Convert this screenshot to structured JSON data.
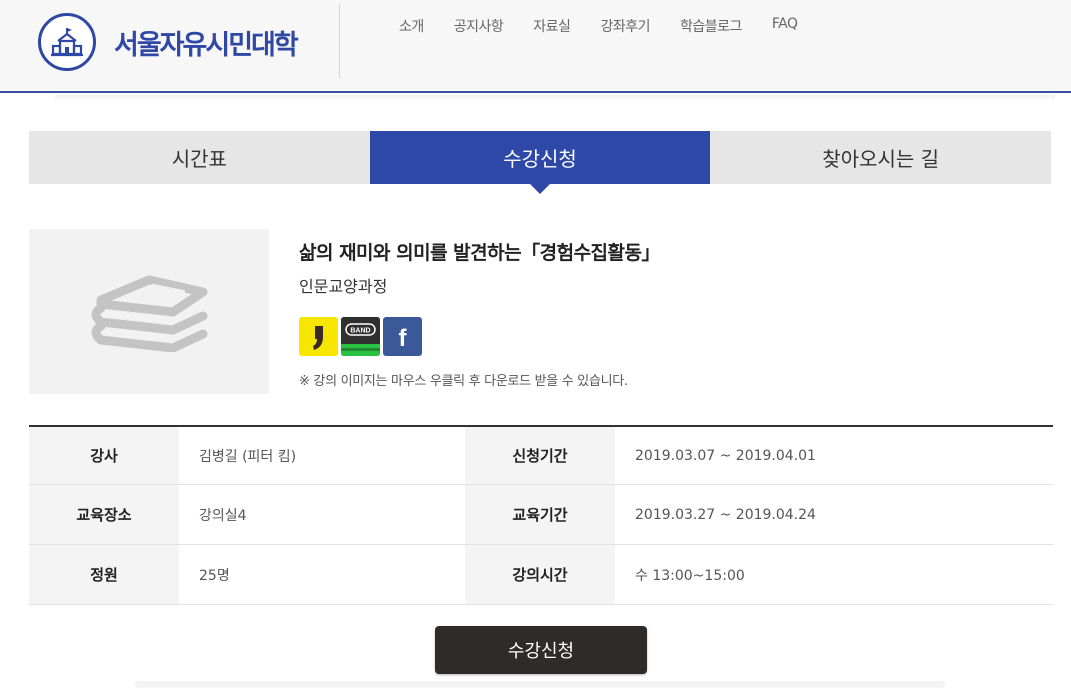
{
  "header": {
    "logo_text": "서울자유시민대학",
    "nav": [
      "소개",
      "공지사항",
      "자료실",
      "강좌후기",
      "학습블로그",
      "FAQ"
    ]
  },
  "tabs": [
    {
      "label": "시간표",
      "active": false
    },
    {
      "label": "수강신청",
      "active": true
    },
    {
      "label": "찾아오시는 길",
      "active": false
    }
  ],
  "course": {
    "title": "삶의 재미와 의미를 발견하는「경험수집활동」",
    "category": "인문교양과정",
    "share": {
      "kakao_icon": "kakao-story-icon",
      "band_label": "BAND",
      "facebook_label": "f"
    },
    "notice": "※ 강의 이미지는 마우스 우클릭 후 다운로드 받을 수 있습니다."
  },
  "info": [
    {
      "label_left": "강사",
      "value_left": "김병길 (피터 킴)",
      "label_right": "신청기간",
      "value_right": "2019.03.07 ~ 2019.04.01"
    },
    {
      "label_left": "교육장소",
      "value_left": "강의실4",
      "label_right": "교육기간",
      "value_right": "2019.03.27 ~ 2019.04.24"
    },
    {
      "label_left": "정원",
      "value_left": "25명",
      "label_right": "강의시간",
      "value_right": "수 13:00~15:00"
    }
  ],
  "submit_label": "수강신청",
  "colors": {
    "accent": "#2e48a8",
    "button_dark": "#2f2b2b",
    "tab_bg": "#e6e6e6"
  }
}
